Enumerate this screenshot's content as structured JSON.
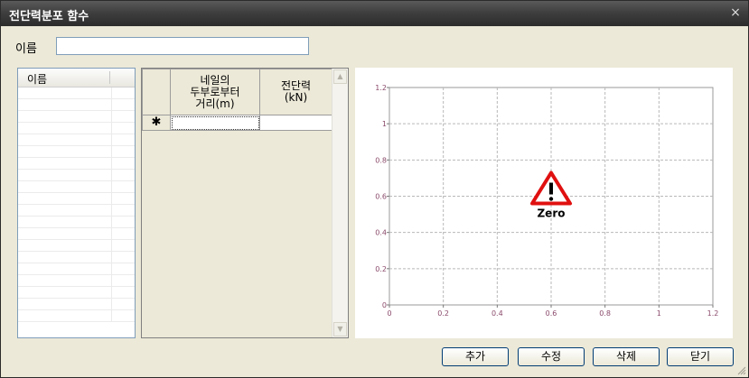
{
  "window": {
    "title": "전단력분포 함수",
    "close_glyph": "×"
  },
  "name_field": {
    "label": "이름",
    "value": ""
  },
  "list": {
    "header": "이름",
    "rows": 20
  },
  "grid": {
    "columns": [
      "네일의\n두부로부터\n거리(m)",
      "전단력\n(kN)"
    ],
    "new_row_marker": "✱"
  },
  "chart_data": {
    "type": "scatter",
    "x": [],
    "y": [],
    "xlim": [
      0,
      1.2
    ],
    "ylim": [
      0,
      1.2
    ],
    "xticks": [
      "0",
      "0.2",
      "0.4",
      "0.6",
      "0.8",
      "1",
      "1.2"
    ],
    "yticks": [
      "0",
      "0.2",
      "0.4",
      "0.6",
      "0.8",
      "1",
      "1.2"
    ],
    "grid": true,
    "warning_label": "Zero"
  },
  "buttons": {
    "add": "추가",
    "edit": "수정",
    "delete": "삭제",
    "close": "닫기"
  }
}
